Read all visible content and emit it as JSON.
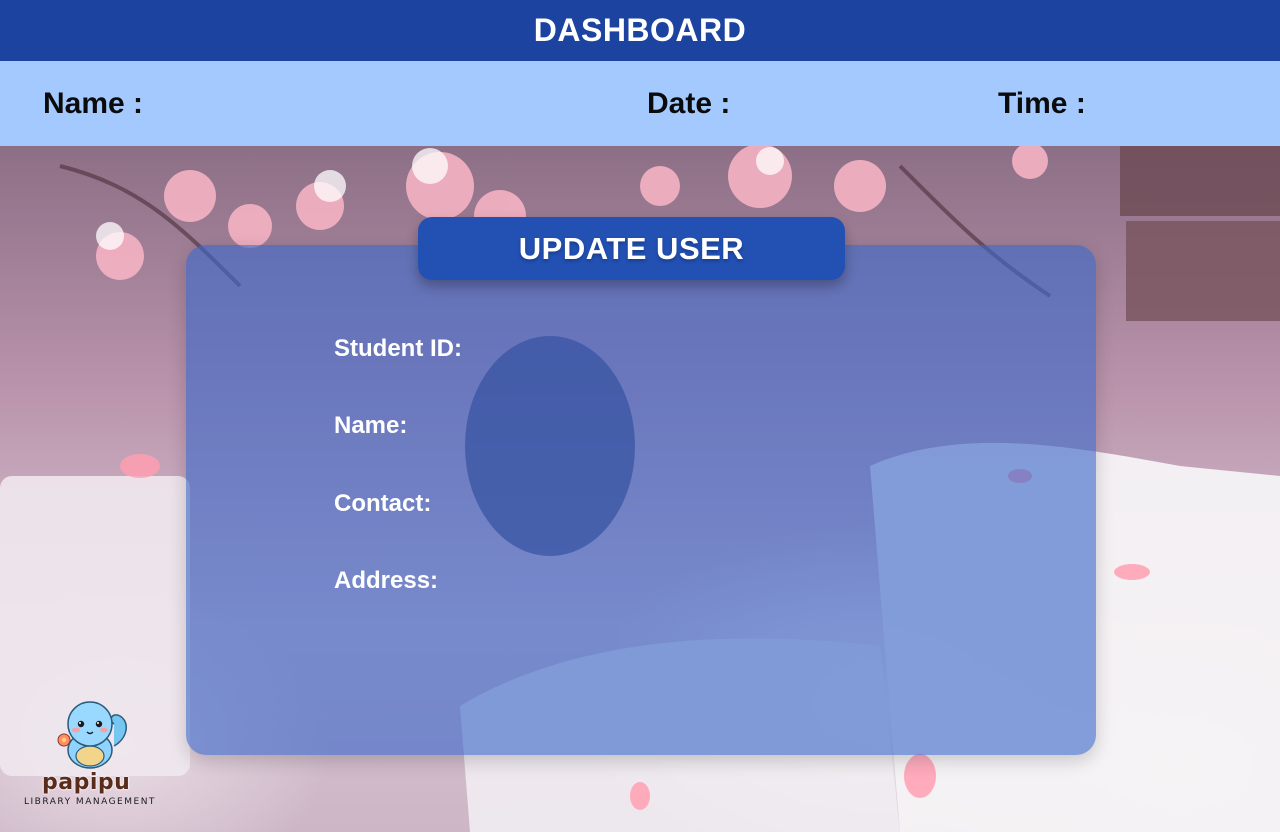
{
  "header": {
    "title": "DASHBOARD"
  },
  "info_bar": {
    "name_label": "Name :",
    "date_label": "Date :",
    "time_label": "Time :"
  },
  "panel": {
    "title": "UPDATE USER",
    "fields": {
      "student_id_label": "Student ID:",
      "name_label": "Name:",
      "contact_label": "Contact:",
      "address_label": "Address:"
    }
  },
  "logo": {
    "brand": "papipu",
    "tagline": "LIBRARY MANAGEMENT"
  },
  "colors": {
    "header_bg": "#1c43a0",
    "info_bar_bg": "#a3c9ff",
    "panel_bg": "#3c68c8",
    "panel_header_bg": "#2250b3"
  }
}
